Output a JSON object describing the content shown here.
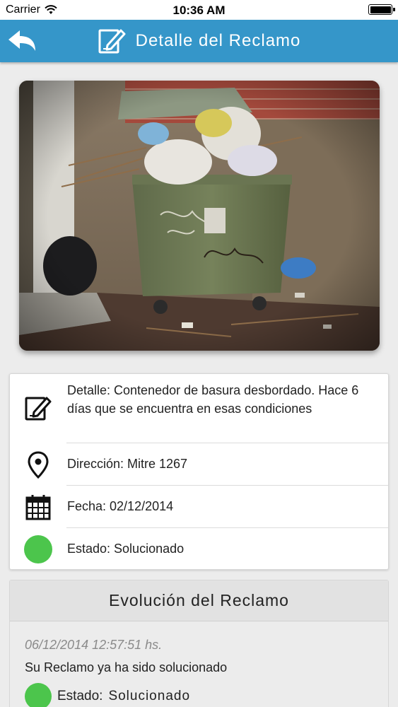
{
  "status_bar": {
    "carrier": "Carrier",
    "time": "10:36 AM"
  },
  "nav": {
    "title": "Detalle del Reclamo",
    "back_icon": "back-arrow-icon",
    "title_icon": "edit-document-icon",
    "color": "#3596c9"
  },
  "photo": {
    "description_icon": "garbage-container-photo"
  },
  "details": {
    "detail": "Detalle: Contenedor de basura desbordado. Hace 6 días que se encuentra en esas condiciones",
    "address": "Dirección: Mitre 1267",
    "date": "Fecha: 02/12/2014",
    "status": "Estado: Solucionado",
    "status_color": "#4cc54c"
  },
  "evolution": {
    "title": "Evolución del Reclamo",
    "entries": [
      {
        "date": "06/12/2014 12:57:51 hs.",
        "message": "Su Reclamo ya ha sido solucionado",
        "status_label": "Estado:",
        "status_value": "Solucionado"
      }
    ]
  }
}
